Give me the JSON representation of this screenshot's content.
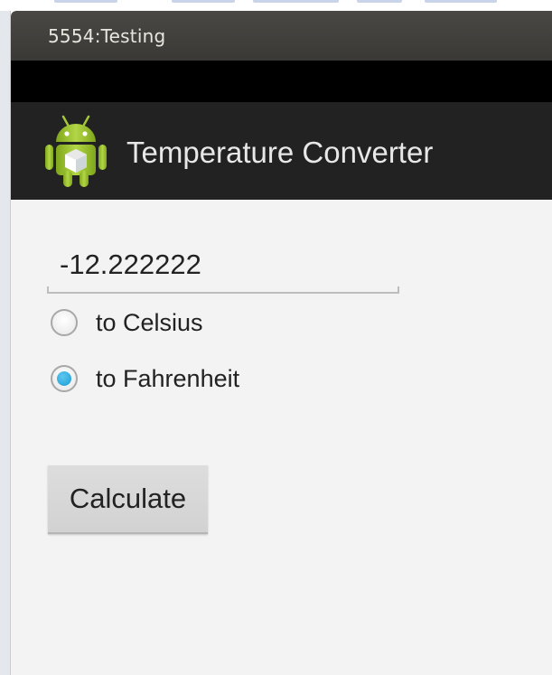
{
  "window": {
    "title": "5554:Testing"
  },
  "action_bar": {
    "app_icon": "android-robot-icon",
    "title": "Temperature Converter"
  },
  "form": {
    "input_value": "-12.222222",
    "radios": [
      {
        "label": "to Celsius",
        "checked": false
      },
      {
        "label": "to Fahrenheit",
        "checked": true
      }
    ],
    "calculate_label": "Calculate"
  },
  "colors": {
    "titlebar": "#3f3e3b",
    "status_bar": "#000000",
    "action_bar": "#222222",
    "content_bg": "#f3f3f3",
    "radio_accent": "#1a9bd6",
    "android_green": "#a4c639"
  }
}
